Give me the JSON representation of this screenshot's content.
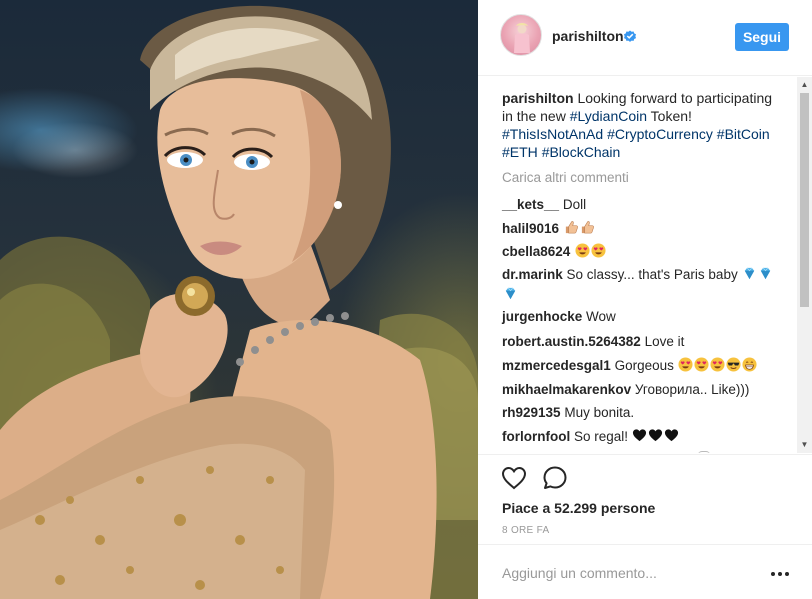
{
  "post": {
    "username": "parishilton",
    "follow_label": "Segui",
    "caption": {
      "author": "parishilton",
      "segments": [
        {
          "text": "Looking forward to participating in the new ",
          "tag": false
        },
        {
          "text": "#LydianCoin",
          "tag": true
        },
        {
          "text": " Token!  ",
          "tag": false
        },
        {
          "text": "#ThisIsNotAnAd",
          "tag": true
        },
        {
          "text": " ",
          "tag": false
        },
        {
          "text": "#CryptoCurrency",
          "tag": true
        },
        {
          "text": " ",
          "tag": false
        },
        {
          "text": "#BitCoin",
          "tag": true
        },
        {
          "text": " ",
          "tag": false
        },
        {
          "text": "#ETH",
          "tag": true
        },
        {
          "text": " ",
          "tag": false
        },
        {
          "text": "#BlockChain",
          "tag": true
        }
      ]
    },
    "load_more_label": "Carica altri commenti",
    "comments": [
      {
        "user": "__kets__",
        "text": "Doll",
        "emojis": []
      },
      {
        "user": "halil9016",
        "text": "",
        "emojis": [
          "thumbs-up-icon",
          "thumbs-up-icon"
        ]
      },
      {
        "user": "cbella8624",
        "text": "",
        "emojis": [
          "heart-eyes-icon",
          "heart-eyes-icon"
        ]
      },
      {
        "user": "dr.marink",
        "text": "So classy... that's Paris baby",
        "emojis": [
          "gem-icon",
          "gem-icon",
          "gem-icon"
        ]
      },
      {
        "user": "jurgenhocke",
        "text": "Wow",
        "emojis": []
      },
      {
        "user": "robert.austin.5264382",
        "text": "Love it",
        "emojis": []
      },
      {
        "user": "mzmercedesgal1",
        "text": "Gorgeous",
        "emojis": [
          "heart-eyes-icon",
          "heart-eyes-icon",
          "heart-eyes-icon",
          "sunglasses-face-icon",
          "grin-icon"
        ]
      },
      {
        "user": "mikhaelmakarenkov",
        "text": "Уговорила.. Like)))",
        "emojis": []
      },
      {
        "user": "rh929135",
        "text": "Muy bonita.",
        "emojis": []
      },
      {
        "user": "forlornfool",
        "text": "So regal!",
        "emojis": [
          "black-heart-icon",
          "black-heart-icon",
          "black-heart-icon"
        ]
      }
    ],
    "likes_text": "Piace a 52.299 persone",
    "time_ago": "8 ORE FA",
    "comment_placeholder": "Aggiungi un commento...",
    "icons": {
      "like": "heart-outline-icon",
      "comment": "speech-bubble-icon",
      "more": "more-options-icon",
      "verified": "verified-badge-icon"
    },
    "colors": {
      "follow_button": "#3897f0",
      "hashtag": "#003569",
      "muted": "#999999",
      "text": "#262626",
      "verified": "#3897f0"
    }
  }
}
